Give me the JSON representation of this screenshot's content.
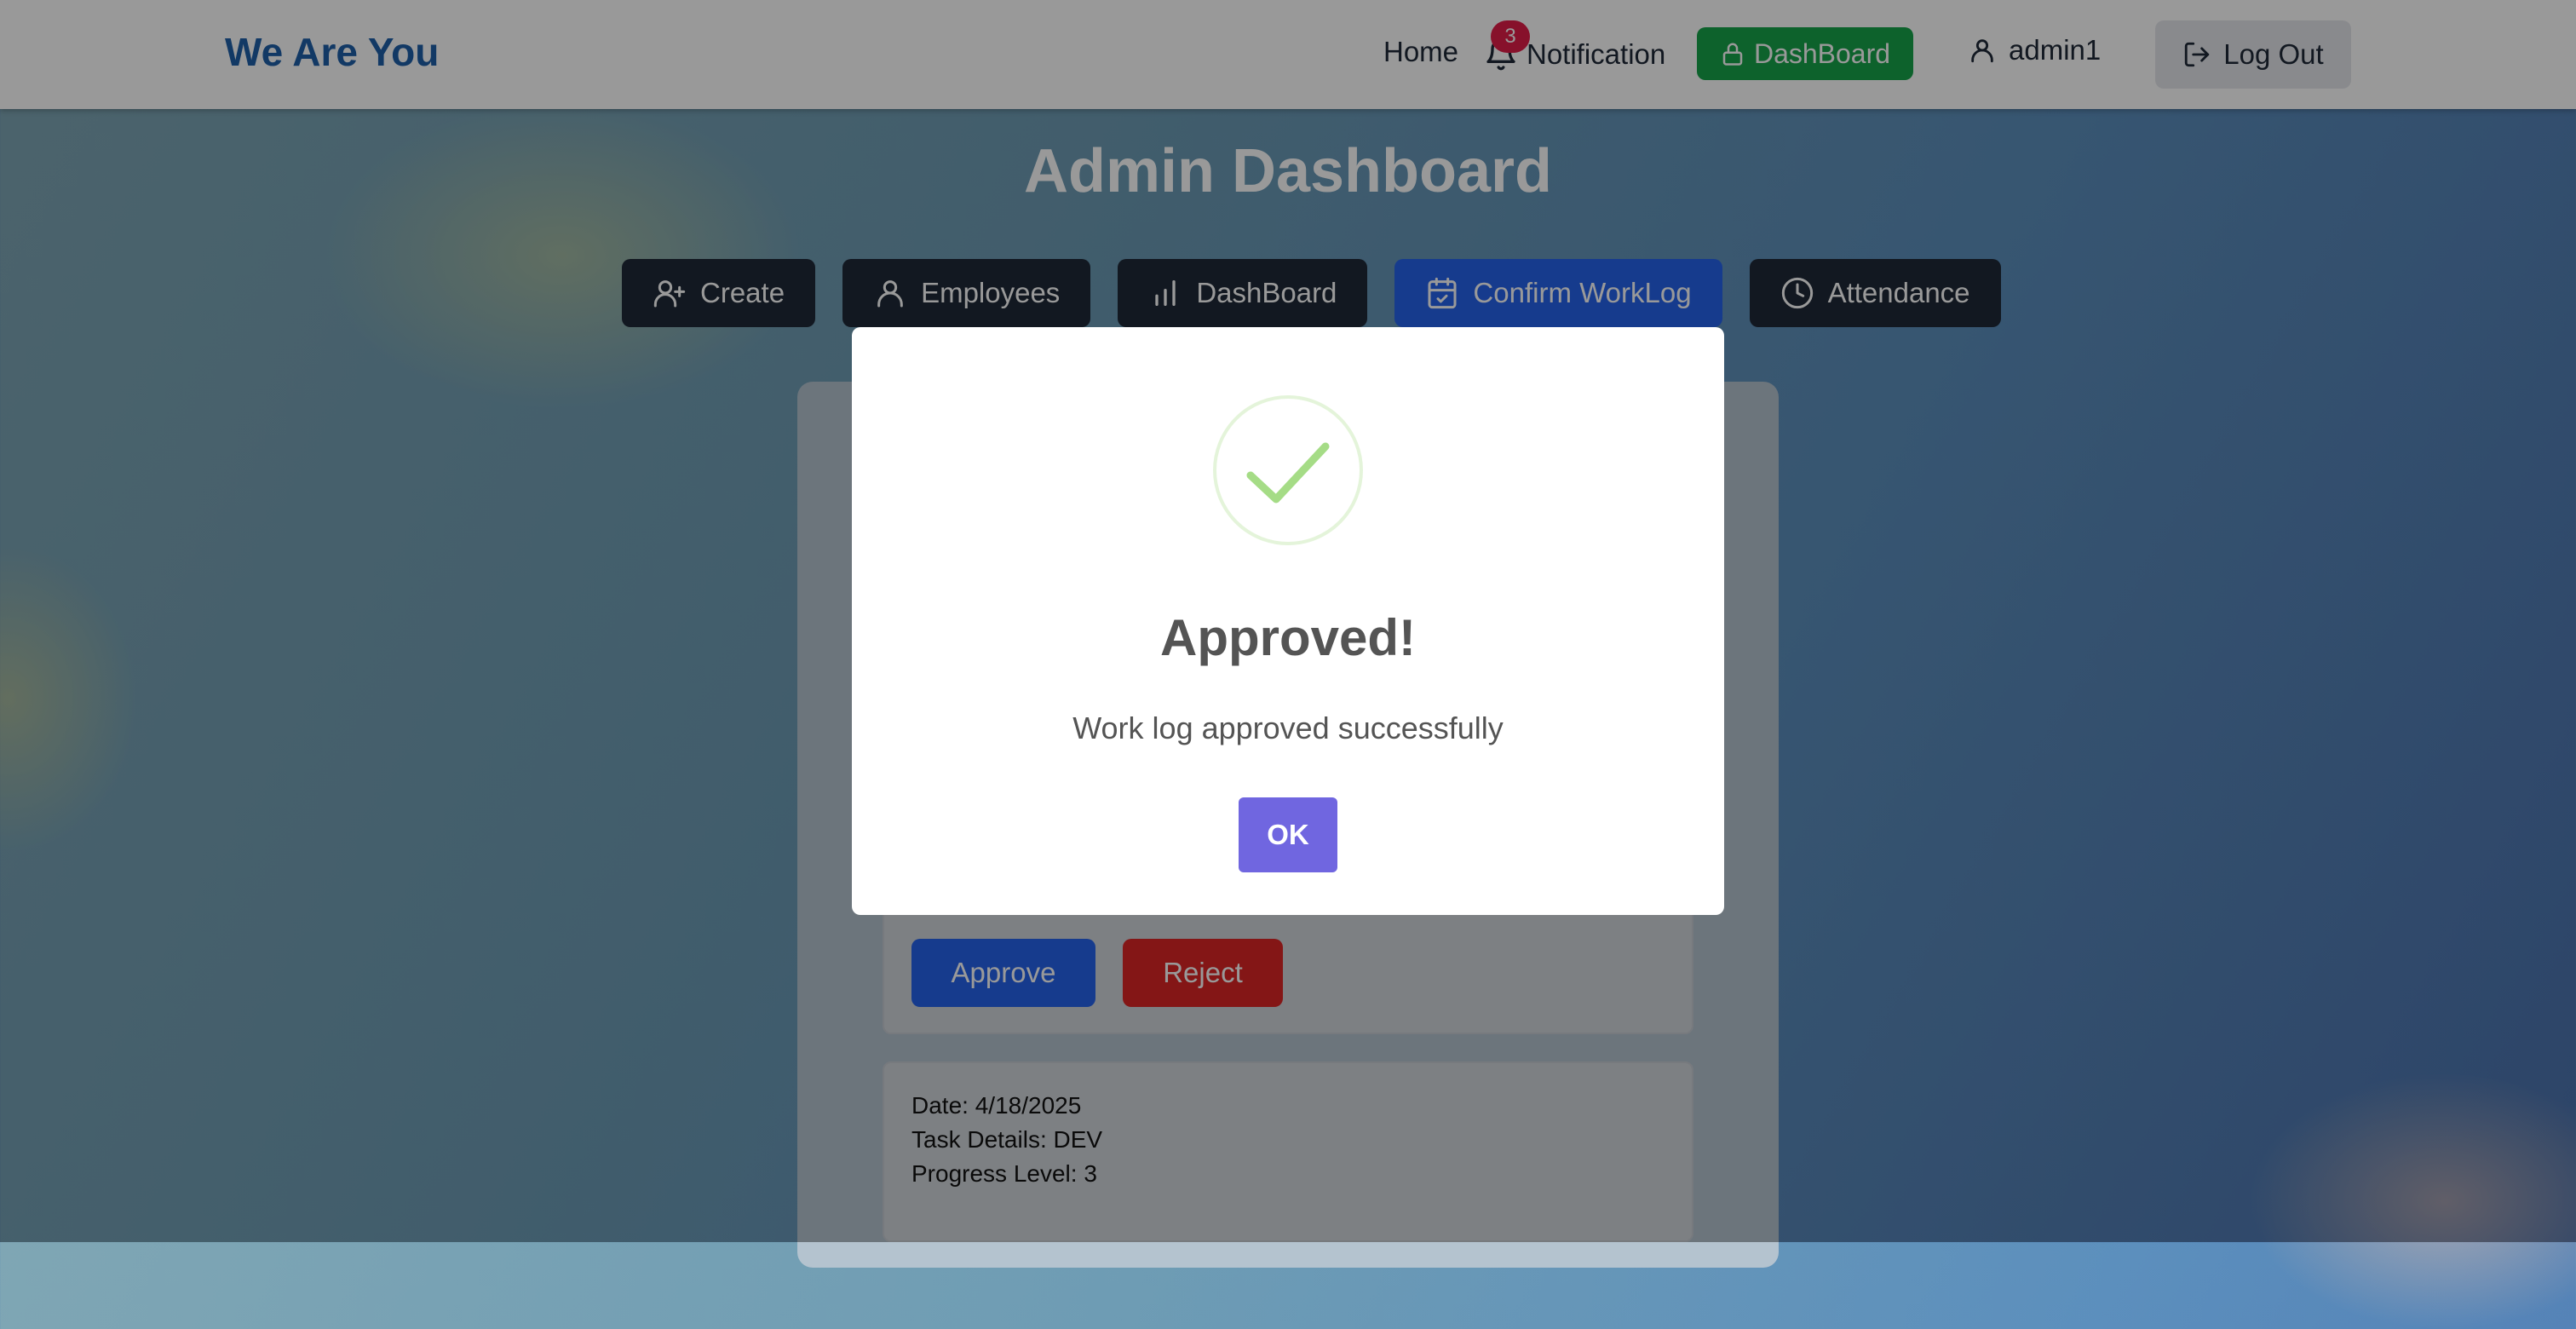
{
  "navbar": {
    "brand": "We Are You",
    "home": "Home",
    "notification_count": "3",
    "notification_label": "Notification",
    "dashboard": "DashBoard",
    "username": "admin1",
    "logout": "Log Out"
  },
  "page": {
    "title": "Admin Dashboard"
  },
  "tabs": [
    {
      "label": "Create",
      "icon": "user-plus-icon"
    },
    {
      "label": "Employees",
      "icon": "user-icon"
    },
    {
      "label": "DashBoard",
      "icon": "bar-chart-icon"
    },
    {
      "label": "Confirm WorkLog",
      "icon": "calendar-check-icon",
      "active": true
    },
    {
      "label": "Attendance",
      "icon": "clock-icon"
    }
  ],
  "worklog": {
    "approve_label": "Approve",
    "reject_label": "Reject",
    "entry": {
      "date_label": "Date",
      "date": "4/18/2025",
      "task_label": "Task Details",
      "task": "DEV",
      "progress_label": "Progress Level",
      "progress": "3"
    }
  },
  "modal": {
    "title": "Approved!",
    "text": "Work log approved successfully",
    "ok_label": "OK",
    "icon": "success-check-icon"
  },
  "colors": {
    "brand": "#1e5fa8",
    "dashboard_green": "#16a34a",
    "active_tab_blue": "#2563eb",
    "approve_blue": "#2563eb",
    "reject_red": "#dc2626",
    "ok_purple": "#7066e0",
    "success_green": "#a5dc86"
  }
}
